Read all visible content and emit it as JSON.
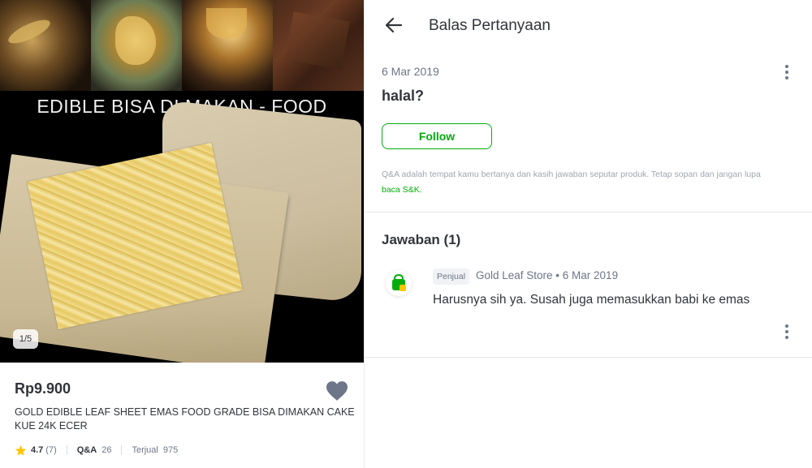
{
  "product": {
    "banner_text": "EDIBLE BISA DI MAKAN - FOOD",
    "image_indicator": "1/5",
    "price": "Rp9.900",
    "title": "GOLD EDIBLE LEAF SHEET EMAS FOOD GRADE BISA DIMAKAN CAKE KUE 24K ECER",
    "rating": "4.7",
    "rating_count": "(7)",
    "qa_label": "Q&A",
    "qa_count": "26",
    "sold_label": "Terjual",
    "sold_count": "975",
    "icons": {
      "wishlist": "heart-icon",
      "rating": "star-icon"
    },
    "colors": {
      "star": "#ffc400",
      "heart": "#6d7588"
    }
  },
  "header": {
    "title": "Balas Pertanyaan",
    "back_icon": "arrow-left-icon"
  },
  "question": {
    "date": "6 Mar 2019",
    "text": "halal?",
    "follow_label": "Follow",
    "disclaimer": "Q&A adalah tempat kamu bertanya dan kasih jawaban seputar produk. Tetap sopan dan jangan lupa",
    "disclaimer_link": "baca S&K."
  },
  "answers": {
    "title": "Jawaban (1)",
    "items": [
      {
        "badge": "Penjual",
        "meta": "Gold Leaf Store • 6 Mar 2019",
        "text": "Harusnya sih ya. Susah juga memasukkan babi ke emas",
        "avatar_icon": "shop-bag-icon"
      }
    ]
  },
  "colors": {
    "accent": "#03ac0e",
    "text_primary": "#31353b",
    "text_secondary": "#6d7588"
  }
}
